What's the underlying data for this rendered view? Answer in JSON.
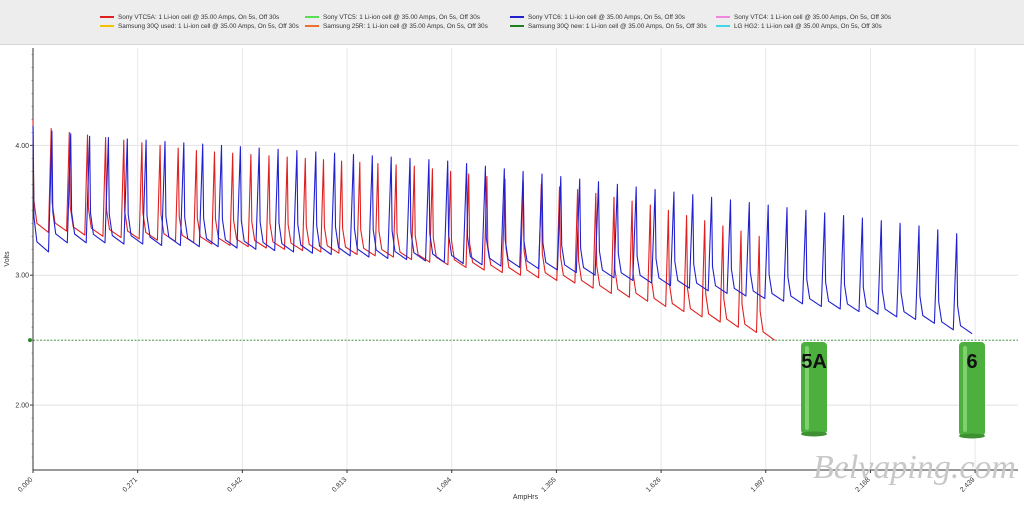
{
  "legend": [
    {
      "label": "Sony VTC5A: 1 Li-ion cell @ 35.00 Amps, On 5s, Off 30s",
      "color": "#e02020"
    },
    {
      "label": "Sony VTC5: 1 Li-ion cell @ 35.00 Amps, On 5s, Off 30s",
      "color": "#55dd55"
    },
    {
      "label": "Sony VTC6: 1 Li-ion cell @ 35.00 Amps, On 5s, Off 30s",
      "color": "#2020d0"
    },
    {
      "label": "Sony VTC4: 1 Li-ion cell @ 35.00 Amps, On 5s, Off 30s",
      "color": "#ee88dd"
    },
    {
      "label": "Samsung 30Q used: 1 Li-ion cell @ 35.00 Amps, On 5s, Off 30s",
      "color": "#f2c200"
    },
    {
      "label": "Samsung 25R: 1 Li-ion cell @ 35.00 Amps, On 5s, Off 30s",
      "color": "#f07030"
    },
    {
      "label": "Samsung 30Q new: 1 Li-ion cell @ 35.00 Amps, On 5s, Off 30s",
      "color": "#208020"
    },
    {
      "label": "LG HG2: 1 Li-ion cell @ 35.00 Amps, On 5s, Off 30s",
      "color": "#40d8e8"
    }
  ],
  "annotations": {
    "cell_5a_label": "5A",
    "cell_6_label": "6",
    "watermark": "Belvaping.com",
    "cell_color": "#4caf3e"
  },
  "chart_data": {
    "type": "line",
    "xlabel": "AmpHrs",
    "ylabel": "Volts",
    "xlim": [
      0,
      2.55
    ],
    "ylim": [
      1.5,
      4.75
    ],
    "x_ticks": [
      "0.000",
      "0.271",
      "0.542",
      "0.813",
      "1.084",
      "1.355",
      "1.626",
      "1.897",
      "2.168",
      "2.439"
    ],
    "x_tick_values": [
      0.0,
      0.271,
      0.542,
      0.813,
      1.084,
      1.355,
      1.626,
      1.897,
      2.168,
      2.439
    ],
    "y_ticks": [
      "2.00",
      "3.00",
      "4.00"
    ],
    "y_tick_values": [
      2.0,
      3.0,
      4.0
    ],
    "cutoff_voltage": 2.5,
    "grid": true,
    "legend_position": "top",
    "series": [
      {
        "name": "Sony VTC5A",
        "color": "#e02020",
        "cycle_step_ah": 0.047,
        "discharge_drop_ah": 0.04,
        "pulse_rest_v": [
          4.2,
          4.13,
          4.1,
          4.08,
          4.06,
          4.04,
          4.02,
          4.0,
          3.98,
          3.96,
          3.95,
          3.94,
          3.93,
          3.92,
          3.91,
          3.9,
          3.89,
          3.88,
          3.87,
          3.86,
          3.85,
          3.84,
          3.82,
          3.8,
          3.78,
          3.76,
          3.74,
          3.72,
          3.7,
          3.68,
          3.66,
          3.63,
          3.6,
          3.57,
          3.54,
          3.5,
          3.46,
          3.42,
          3.38,
          3.34,
          3.3
        ],
        "pulse_loaded_v": [
          3.33,
          3.34,
          3.31,
          3.3,
          3.29,
          3.28,
          3.27,
          3.26,
          3.25,
          3.24,
          3.23,
          3.22,
          3.21,
          3.2,
          3.19,
          3.18,
          3.17,
          3.16,
          3.15,
          3.14,
          3.12,
          3.1,
          3.08,
          3.06,
          3.04,
          3.02,
          3.0,
          2.98,
          2.96,
          2.94,
          2.9,
          2.86,
          2.83,
          2.8,
          2.76,
          2.72,
          2.68,
          2.64,
          2.6,
          2.56,
          2.5
        ]
      },
      {
        "name": "Sony VTC6",
        "color": "#2020d0",
        "cycle_step_ah": 0.0488,
        "discharge_drop_ah": 0.04,
        "pulse_rest_v": [
          4.15,
          4.11,
          4.09,
          4.07,
          4.06,
          4.05,
          4.04,
          4.03,
          4.02,
          4.01,
          4.0,
          3.99,
          3.98,
          3.97,
          3.96,
          3.95,
          3.94,
          3.93,
          3.92,
          3.91,
          3.9,
          3.89,
          3.88,
          3.86,
          3.84,
          3.82,
          3.8,
          3.78,
          3.76,
          3.74,
          3.72,
          3.7,
          3.68,
          3.66,
          3.64,
          3.62,
          3.6,
          3.58,
          3.56,
          3.54,
          3.52,
          3.5,
          3.48,
          3.46,
          3.44,
          3.42,
          3.4,
          3.38,
          3.35,
          3.32
        ],
        "pulse_loaded_v": [
          3.18,
          3.25,
          3.25,
          3.25,
          3.24,
          3.24,
          3.23,
          3.23,
          3.22,
          3.22,
          3.21,
          3.2,
          3.19,
          3.18,
          3.17,
          3.16,
          3.15,
          3.14,
          3.13,
          3.12,
          3.11,
          3.1,
          3.09,
          3.08,
          3.07,
          3.06,
          3.05,
          3.04,
          3.02,
          3.0,
          2.98,
          2.96,
          2.94,
          2.92,
          2.9,
          2.88,
          2.86,
          2.84,
          2.82,
          2.8,
          2.78,
          2.76,
          2.74,
          2.72,
          2.7,
          2.68,
          2.66,
          2.63,
          2.58,
          2.55
        ]
      }
    ]
  }
}
